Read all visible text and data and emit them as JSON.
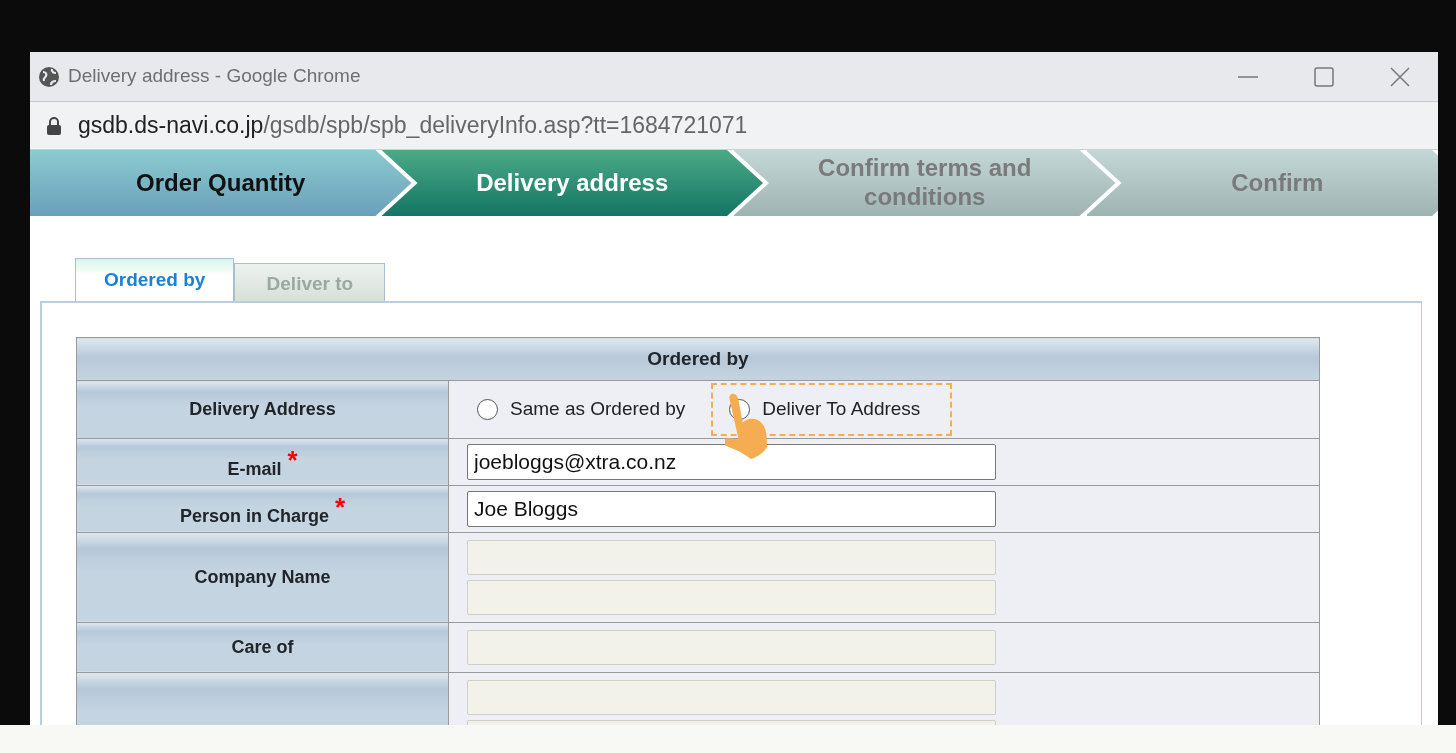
{
  "window": {
    "title": "Delivery address - Google Chrome",
    "url_host": "gsdb.ds-navi.co.jp",
    "url_path": "/gsdb/spb/spb_deliveryInfo.asp?tt=1684721071"
  },
  "steps": [
    {
      "label": "Order Quantity",
      "kind": "done"
    },
    {
      "label": "Delivery address",
      "kind": "current"
    },
    {
      "label": "Confirm terms and conditions",
      "kind": "upcoming"
    },
    {
      "label": "Confirm",
      "kind": "upcoming"
    }
  ],
  "tabs": [
    {
      "label": "Ordered by",
      "selected": true
    },
    {
      "label": "Deliver to",
      "selected": false
    }
  ],
  "form": {
    "heading": "Ordered by",
    "rows": [
      {
        "kind": "radio",
        "label": "Delivery Address",
        "options": [
          {
            "label": "Same as Ordered by",
            "selected": false,
            "highlighted": false
          },
          {
            "label": "Deliver To Address",
            "selected": false,
            "highlighted": true
          }
        ]
      },
      {
        "kind": "fields",
        "label": "E-mail",
        "required_mark": "*",
        "fields": [
          {
            "value": "joebloggs@xtra.co.nz",
            "disabled": false
          }
        ]
      },
      {
        "kind": "fields",
        "label": "Person in Charge",
        "required_mark": "*",
        "fields": [
          {
            "value": "Joe Bloggs",
            "disabled": false
          }
        ]
      },
      {
        "kind": "fields",
        "label": "Company Name",
        "fields": [
          {
            "disabled": true
          },
          {
            "disabled": true
          }
        ]
      },
      {
        "kind": "fields",
        "label": "Care of",
        "fields": [
          {
            "disabled": true
          }
        ]
      },
      {
        "kind": "fields",
        "fields": [
          {
            "disabled": true
          },
          {
            "disabled": true
          }
        ]
      }
    ]
  }
}
